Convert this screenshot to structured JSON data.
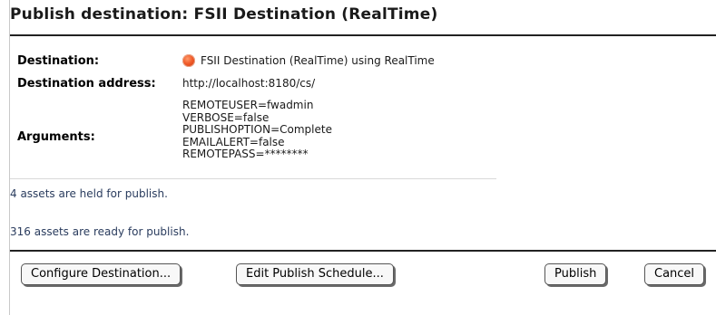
{
  "header": {
    "title": "Publish destination: FSII Destination (RealTime)"
  },
  "details": {
    "destination_label": "Destination:",
    "destination_value": "FSII Destination (RealTime) using RealTime",
    "destination_status_color": "#f05a28",
    "address_label": "Destination address:",
    "address_value": "http://localhost:8180/cs/",
    "arguments_label": "Arguments:",
    "arguments": [
      "REMOTEUSER=fwadmin",
      "VERBOSE=false",
      "PUBLISHOPTION=Complete",
      "EMAILALERT=false",
      "REMOTEPASS=********"
    ]
  },
  "status": {
    "held_text": "4 assets are held for publish.",
    "ready_text": "316 assets are ready for publish."
  },
  "actions": {
    "configure_label": "Configure Destination...",
    "schedule_label": "Edit Publish Schedule...",
    "publish_label": "Publish",
    "cancel_label": "Cancel"
  }
}
